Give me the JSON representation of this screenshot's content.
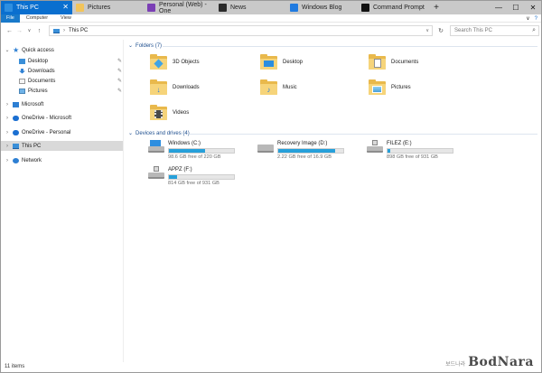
{
  "tabs": [
    {
      "label": "This PC",
      "active": true,
      "color": "#2f8fe0"
    },
    {
      "label": "Pictures",
      "active": false,
      "color": "#f2c45a"
    },
    {
      "label": "Personal (Web) - One",
      "active": false,
      "color": "#7b3fb5"
    },
    {
      "label": "News",
      "active": false,
      "color": "#2b2b2b"
    },
    {
      "label": "Windows Blog",
      "active": false,
      "color": "#1f7ae0"
    },
    {
      "label": "Command Prompt",
      "active": false,
      "color": "#111111"
    }
  ],
  "tab_close_glyph": "✕",
  "new_tab_glyph": "+",
  "window_controls": {
    "minimize": "—",
    "maximize": "☐",
    "close": "✕"
  },
  "ribbon": {
    "tabs": [
      "File",
      "Computer",
      "View"
    ],
    "help": "?",
    "expand": "∨"
  },
  "nav": {
    "back": "←",
    "forward": "→",
    "recent": "∨",
    "up": "↑",
    "address": "This PC",
    "refresh": "↻",
    "search_placeholder": "Search This PC",
    "search_icon": "⌕"
  },
  "sidebar": {
    "quick_access": {
      "label": "Quick access",
      "items": [
        {
          "label": "Desktop",
          "pinned": true
        },
        {
          "label": "Downloads",
          "pinned": true
        },
        {
          "label": "Documents",
          "pinned": true
        },
        {
          "label": "Pictures",
          "pinned": true
        }
      ]
    },
    "pin_glyph": "✎",
    "roots": [
      {
        "label": "Microsoft",
        "icon": "building-icon",
        "color": "#2d7fd3"
      },
      {
        "label": "OneDrive - Microsoft",
        "icon": "cloud-icon",
        "color": "#1b6fd1"
      },
      {
        "label": "OneDrive - Personal",
        "icon": "cloud-icon",
        "color": "#1b6fd1"
      },
      {
        "label": "This PC",
        "icon": "monitor-icon",
        "color": "#3a8fd8",
        "selected": true
      },
      {
        "label": "Network",
        "icon": "network-icon",
        "color": "#2d7fd3"
      }
    ]
  },
  "folders_group": {
    "label": "Folders (7)",
    "items": [
      {
        "label": "3D Objects",
        "icon": "cube-icon"
      },
      {
        "label": "Desktop",
        "icon": "desktop-icon"
      },
      {
        "label": "Documents",
        "icon": "document-icon"
      },
      {
        "label": "Downloads",
        "icon": "download-arrow-icon"
      },
      {
        "label": "Music",
        "icon": "music-note-icon"
      },
      {
        "label": "Pictures",
        "icon": "picture-icon"
      },
      {
        "label": "Videos",
        "icon": "film-icon"
      }
    ]
  },
  "drives_group": {
    "label": "Devices and drives (4)",
    "items": [
      {
        "label": "Windows (C:)",
        "free": "98.6 GB free of 220 GB",
        "used_fraction": 0.55,
        "icon": "windows-drive-icon"
      },
      {
        "label": "Recovery Image (D:)",
        "free": "2.22 GB free of 16.9 GB",
        "used_fraction": 0.87,
        "icon": "drive-icon"
      },
      {
        "label": "FILEZ (E:)",
        "free": "898 GB free of 931 GB",
        "used_fraction": 0.04,
        "icon": "usb-drive-icon"
      },
      {
        "label": "APPZ (F:)",
        "free": "814 GB free of 931 GB",
        "used_fraction": 0.13,
        "icon": "usb-drive-icon"
      }
    ]
  },
  "status": {
    "items": "11 items"
  },
  "watermark": {
    "logo": "BodNara",
    "brand": "보드나라"
  }
}
